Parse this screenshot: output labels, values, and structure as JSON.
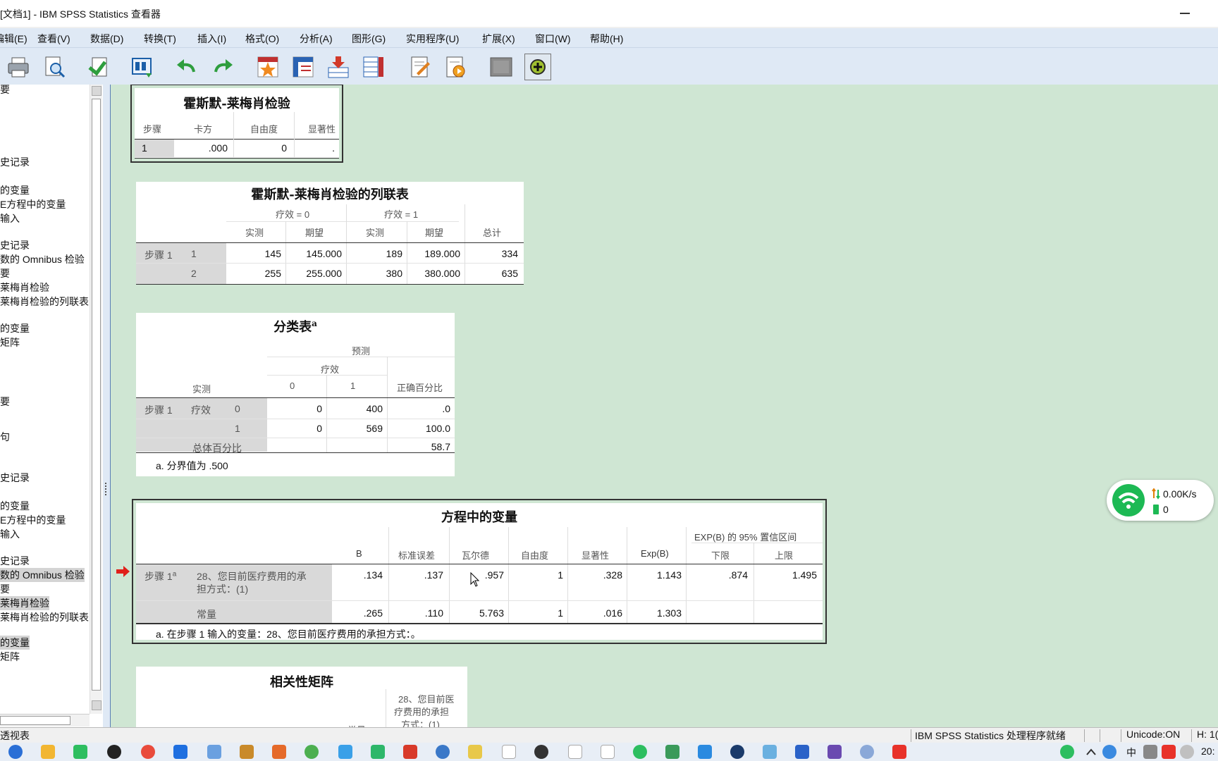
{
  "window": {
    "title": "[文档1] - IBM SPSS Statistics 查看器"
  },
  "menu": [
    "编辑(E)",
    "查看(V)",
    "数据(D)",
    "转换(T)",
    "插入(I)",
    "格式(O)",
    "分析(A)",
    "图形(G)",
    "实用程序(U)",
    "扩展(X)",
    "窗口(W)",
    "帮助(H)"
  ],
  "toolbar": [
    "print-icon",
    "print-preview-icon",
    "export-icon",
    "recall-dialog-icon",
    "undo-icon",
    "redo-icon",
    "goto-case-icon",
    "goto-variable-icon",
    "insert-cases-icon",
    "insert-variable-icon",
    "designate-window-icon",
    "script-icon",
    "promote-icon",
    "add-icon"
  ],
  "outline": [
    {
      "text": "要",
      "sel": false
    },
    {
      "text": "史记录",
      "sel": false
    },
    {
      "text": "的变量",
      "sel": false
    },
    {
      "text": "E方程中的变量",
      "sel": false
    },
    {
      "text": "输入",
      "sel": false
    },
    {
      "text": "史记录",
      "sel": false
    },
    {
      "text": "数的 Omnibus 检验",
      "sel": false
    },
    {
      "text": "要",
      "sel": false
    },
    {
      "text": "莱梅肖检验",
      "sel": false
    },
    {
      "text": "莱梅肖检验的列联表",
      "sel": false
    },
    {
      "text": "的变量",
      "sel": false
    },
    {
      "text": "矩阵",
      "sel": false
    },
    {
      "text": "要",
      "sel": false
    },
    {
      "text": "句",
      "sel": false
    },
    {
      "text": "史记录",
      "sel": false
    },
    {
      "text": "的变量",
      "sel": false
    },
    {
      "text": "E方程中的变量",
      "sel": false
    },
    {
      "text": "输入",
      "sel": false
    },
    {
      "text": "史记录",
      "sel": false
    },
    {
      "text": "数的 Omnibus 检验",
      "sel": true
    },
    {
      "text": "要",
      "sel": false
    },
    {
      "text": "莱梅肖检验",
      "sel": true
    },
    {
      "text": "莱梅肖检验的列联表",
      "sel": false
    },
    {
      "text": "的变量",
      "sel": true
    },
    {
      "text": "矩阵",
      "sel": false
    }
  ],
  "hl_test": {
    "title": "霍斯默-莱梅肖检验",
    "headers": [
      "步骤",
      "卡方",
      "自由度",
      "显著性"
    ],
    "rows": [
      [
        "1",
        ".000",
        "0",
        "."
      ]
    ]
  },
  "contingency": {
    "title": "霍斯默-莱梅肖检验的列联表",
    "group0": "疗效 = 0",
    "group1": "疗效 = 1",
    "sub": [
      "实测",
      "期望",
      "实测",
      "期望",
      "总计"
    ],
    "step_label": "步骤 1",
    "rows": [
      [
        "1",
        "145",
        "145.000",
        "189",
        "189.000",
        "334"
      ],
      [
        "2",
        "255",
        "255.000",
        "380",
        "380.000",
        "635"
      ]
    ]
  },
  "classification": {
    "title": "分类表",
    "sup": "a",
    "predicted": "预测",
    "var": "疗效",
    "observed": "实测",
    "col0": "0",
    "col1": "1",
    "pct": "正确百分比",
    "step_label": "步骤 1",
    "row_var": "疗效",
    "rows": [
      [
        "0",
        "0",
        "400",
        ".0"
      ],
      [
        "1",
        "0",
        "569",
        "100.0"
      ]
    ],
    "overall_label": "总体百分比",
    "overall_value": "58.7",
    "footnote": "a. 分界值为 .500"
  },
  "equation": {
    "title": "方程中的变量",
    "ci_header": "EXP(B) 的 95% 置信区间",
    "headers": [
      "B",
      "标准误差",
      "瓦尔德",
      "自由度",
      "显著性",
      "Exp(B)",
      "下限",
      "上限"
    ],
    "step_label": "步骤 1",
    "step_sup": "a",
    "var_label_1": "28、您目前医疗费用的承",
    "var_label_2": "担方式：(1)",
    "row1": [
      ".134",
      ".137",
      ".957",
      "1",
      ".328",
      "1.143",
      ".874",
      "1.495"
    ],
    "const_label": "常量",
    "row2": [
      ".265",
      ".110",
      "5.763",
      "1",
      ".016",
      "1.303",
      "",
      ""
    ],
    "footnote": "a. 在步骤 1 输入的变量：28、您目前医疗费用的承担方式：。"
  },
  "correlation": {
    "title": "相关性矩阵",
    "col_1": "28、您目前医",
    "col_2": "疗费用的承担",
    "col_3": "方式：(1)",
    "row_hint": "常量"
  },
  "net_widget": {
    "speed": "0.00K/s",
    "count": "0"
  },
  "status": {
    "left": "透视表",
    "processor": "IBM SPSS Statistics 处理程序就绪",
    "unicode": "Unicode:ON",
    "h": "H: 1("
  },
  "taskbar": {
    "ime": "中",
    "time": "20:"
  }
}
